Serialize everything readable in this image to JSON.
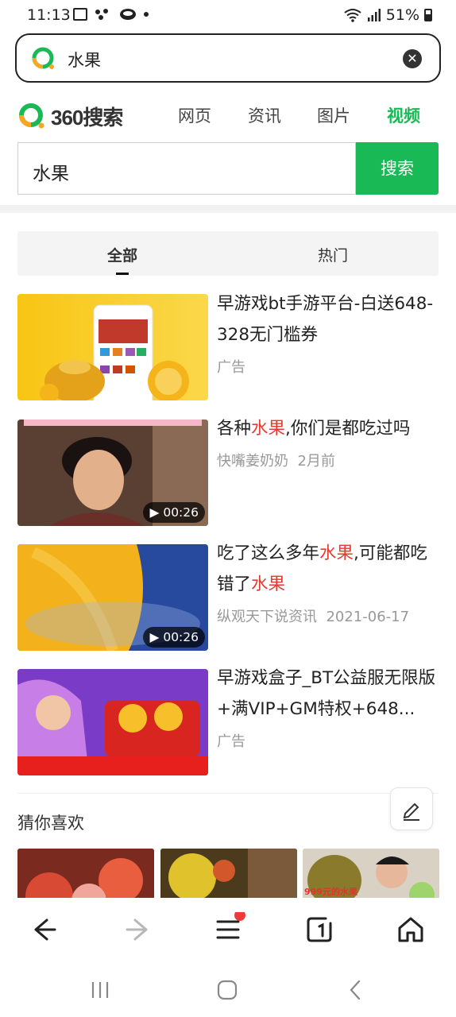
{
  "status_bar": {
    "time": "11:13",
    "battery": "51%"
  },
  "address_bar": {
    "query": "水果"
  },
  "site": {
    "brand": "360搜索",
    "nav": [
      {
        "label": "网页",
        "active": false
      },
      {
        "label": "资讯",
        "active": false
      },
      {
        "label": "图片",
        "active": false
      },
      {
        "label": "视频",
        "active": true
      }
    ],
    "search_value": "水果",
    "search_button": "搜索"
  },
  "tabs": [
    {
      "label": "全部",
      "active": true
    },
    {
      "label": "热门",
      "active": false
    }
  ],
  "results": [
    {
      "title_parts": [
        "早游戏bt手游平台-白送648-328无门槛券"
      ],
      "meta_source": "广告",
      "meta_date": "",
      "duration": ""
    },
    {
      "title_a": "各种",
      "title_hl": "水果",
      "title_b": ",你们是都吃过吗",
      "meta_source": "快嘴姜奶奶",
      "meta_date": "2月前",
      "duration": "00:26"
    },
    {
      "title_a": "吃了这么多年",
      "title_hl": "水果",
      "title_b": ",可能都吃错了",
      "title_hl2": "水果",
      "meta_source": "纵观天下说资讯",
      "meta_date": "2021-06-17",
      "duration": "00:26"
    },
    {
      "title_parts": [
        "早游戏盒子_BT公益服无限版+满VIP+GM特权+648..."
      ],
      "meta_source": "广告",
      "meta_date": "",
      "duration": ""
    }
  ],
  "guess": {
    "title": "猜你喜欢",
    "thumb3_caption": "999元的水果"
  },
  "icons": {
    "back": "arrow-left-icon",
    "forward": "arrow-right-icon",
    "menu": "menu-icon",
    "tabs": "tab-switch-icon",
    "home": "home-icon",
    "clear": "clear-icon",
    "edit": "edit-icon"
  },
  "colors": {
    "accent": "#19b955",
    "highlight": "#e33b2f",
    "notification": "#f03b3b"
  }
}
